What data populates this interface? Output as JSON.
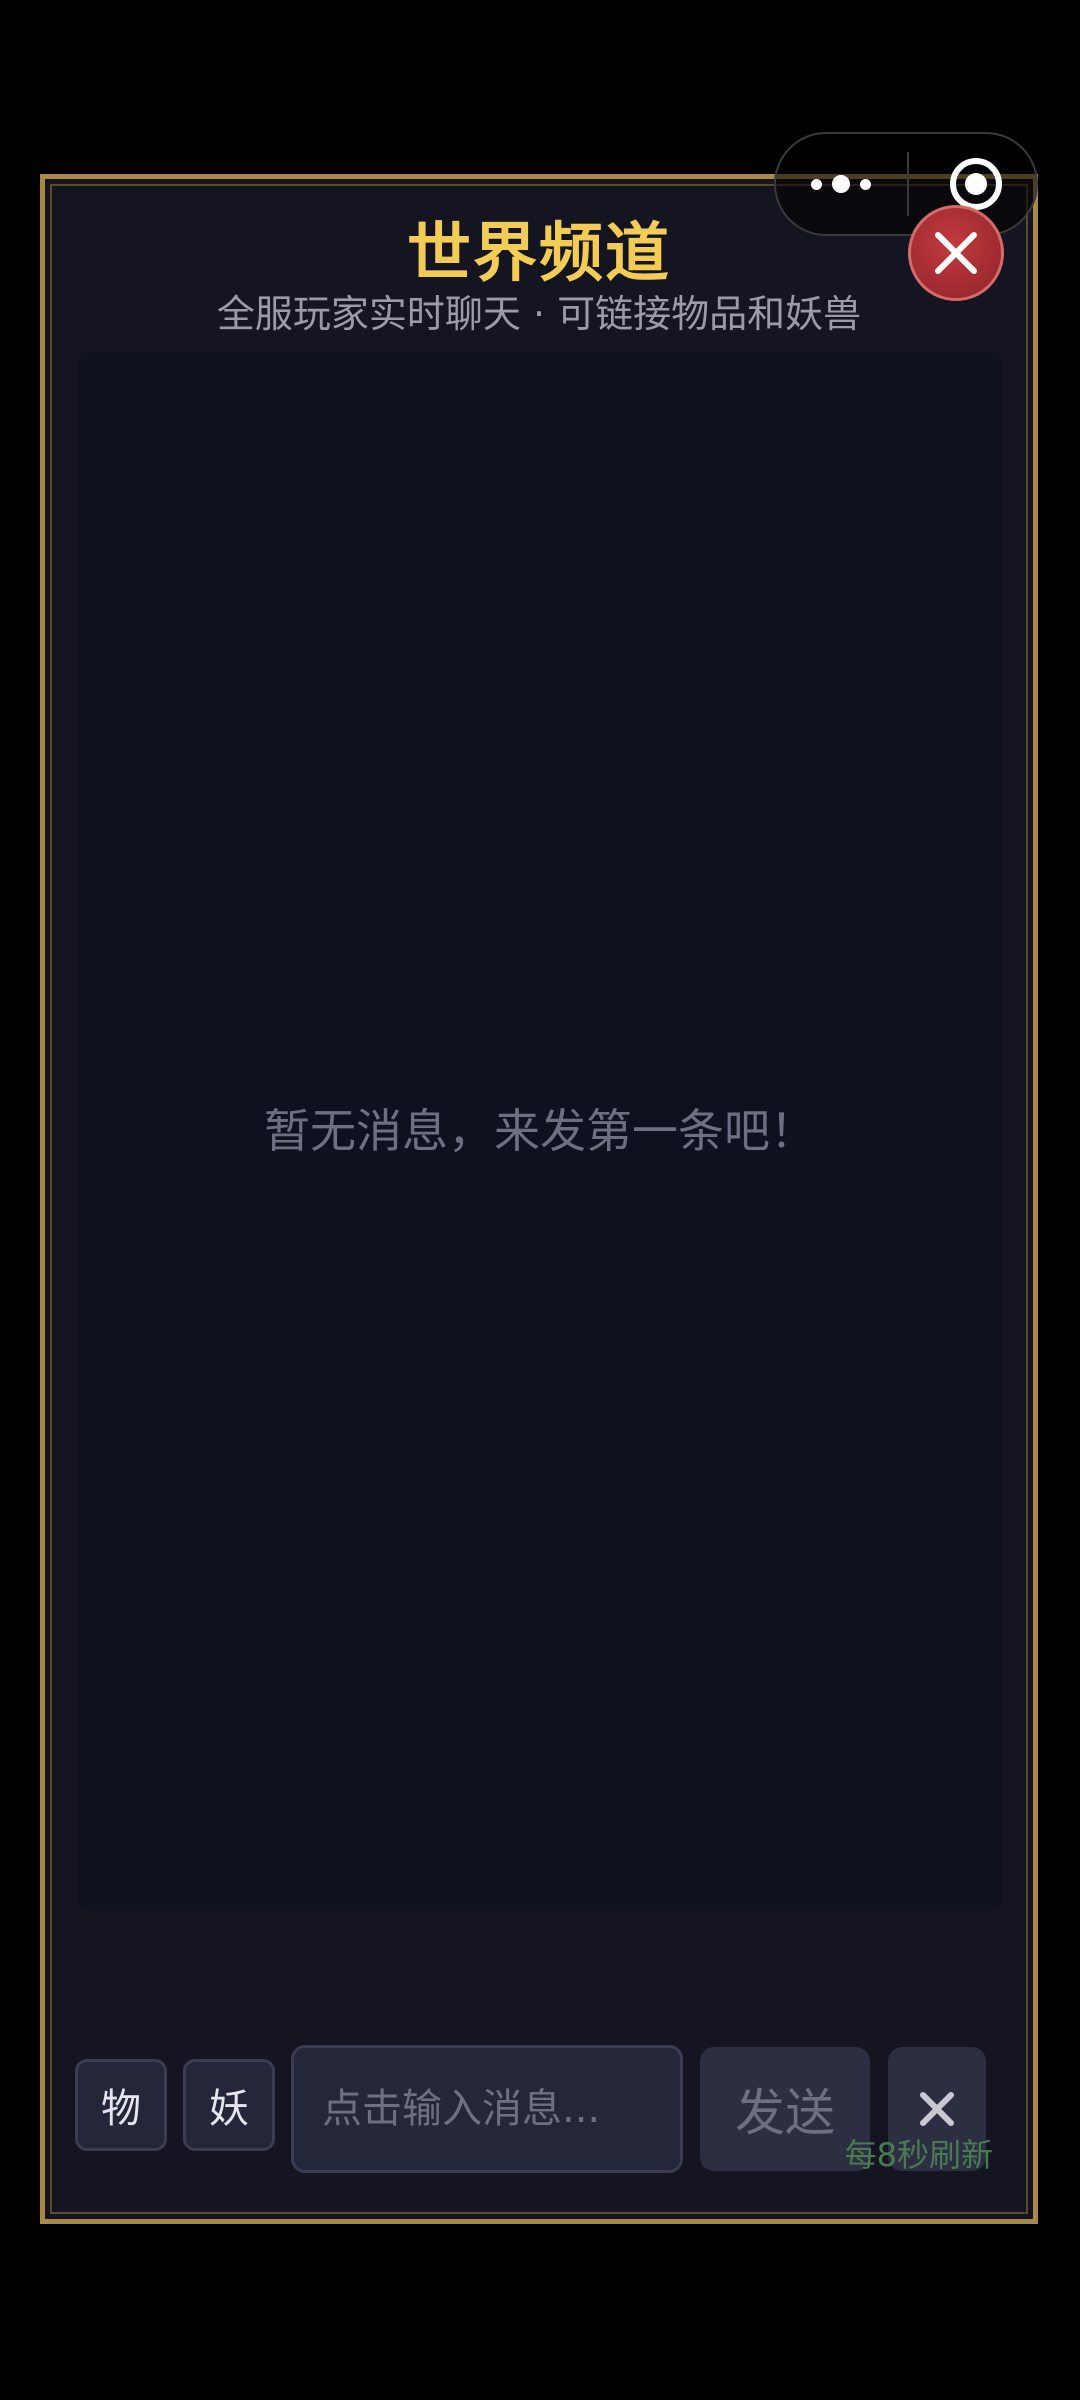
{
  "header": {
    "title": "世界频道",
    "subtitle": "全服玩家实时聊天 · 可链接物品和妖兽"
  },
  "messages": {
    "empty_text": "暂无消息，来发第一条吧！"
  },
  "composer": {
    "item_tag_label": "物",
    "beast_tag_label": "妖",
    "input_placeholder": "点击输入消息...",
    "input_value": "",
    "send_label": "发送",
    "refresh_hint": "每8秒刷新"
  },
  "icons": {
    "close": "close-icon",
    "clear": "close-icon",
    "capsule_more": "more-icon",
    "capsule_exit": "target-icon"
  },
  "colors": {
    "border_gold": "#a8894a",
    "title_gold": "#f3cc55",
    "close_red": "#9e2a30",
    "hint_green": "#4a7a52",
    "panel_bg": "#141521"
  }
}
